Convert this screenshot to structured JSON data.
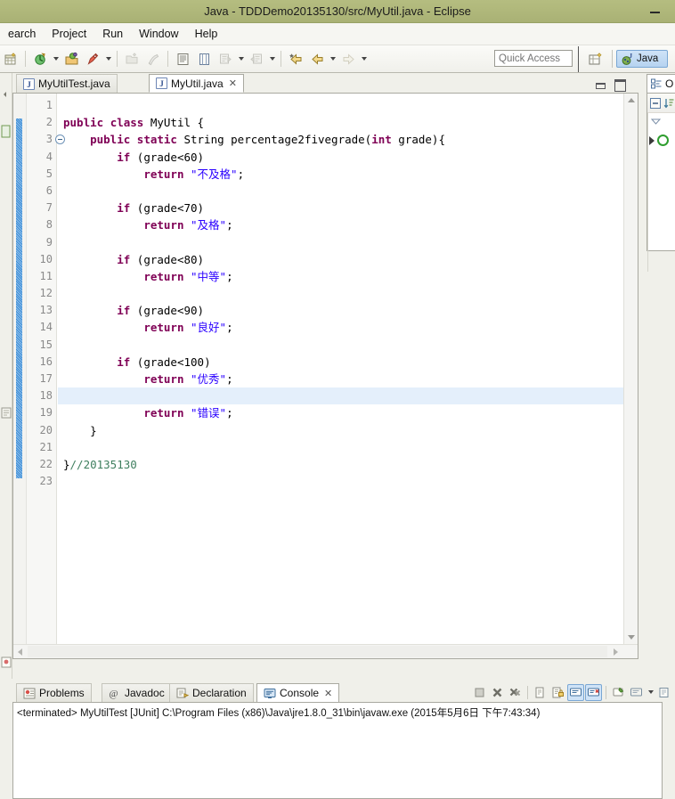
{
  "window": {
    "title": "Java - TDDDemo20135130/src/MyUtil.java - Eclipse",
    "minimize_label": "Minimize",
    "titlebar_color": "#b0b87b"
  },
  "menubar": {
    "items": [
      {
        "label": "earch",
        "name": "menu-search"
      },
      {
        "label": "Project",
        "name": "menu-project"
      },
      {
        "label": "Run",
        "name": "menu-run"
      },
      {
        "label": "Window",
        "name": "menu-window"
      },
      {
        "label": "Help",
        "name": "menu-help"
      }
    ]
  },
  "toolbar": {
    "buttons": [
      {
        "icon": "new-wizard-icon",
        "label": "New"
      },
      {
        "icon": "debug-icon",
        "label": "Debug"
      },
      {
        "icon": "run-icon",
        "label": "Run"
      },
      {
        "icon": "run-external-tools-icon",
        "label": "External Tools"
      },
      {
        "icon": "new-java-package-icon",
        "label": "New Java Package"
      },
      {
        "icon": "skip-breakpoints-icon",
        "label": "Skip All Breakpoints"
      },
      {
        "icon": "open-type-icon",
        "label": "Open Type"
      },
      {
        "icon": "open-task-icon",
        "label": "Open Task"
      },
      {
        "icon": "next-annotation-icon",
        "label": "Next Annotation"
      },
      {
        "icon": "previous-annotation-icon",
        "label": "Previous Annotation"
      },
      {
        "icon": "back-icon",
        "label": "Back"
      },
      {
        "icon": "forward-icon",
        "label": "Forward"
      }
    ],
    "quick_access_placeholder": "Quick Access",
    "open_perspective_label": "Open Perspective",
    "perspective_label": "Java"
  },
  "editor": {
    "tabs": [
      {
        "label": "MyUtilTest.java",
        "active": false,
        "closable": false
      },
      {
        "label": "MyUtil.java",
        "active": true,
        "closable": true,
        "close_glyph": "✕"
      }
    ],
    "minimize_label": "Minimize",
    "maximize_label": "Maximize",
    "current_line": 18,
    "lines": [
      {
        "n": 1,
        "folds": false,
        "tokens": []
      },
      {
        "n": 2,
        "folds": false,
        "tokens": [
          {
            "t": "public",
            "c": "kw"
          },
          {
            "t": " ",
            "c": "id"
          },
          {
            "t": "class",
            "c": "kw"
          },
          {
            "t": " MyUtil {",
            "c": "id"
          }
        ]
      },
      {
        "n": 3,
        "folds": true,
        "tokens": [
          {
            "t": "    ",
            "c": "id"
          },
          {
            "t": "public",
            "c": "kw"
          },
          {
            "t": " ",
            "c": "id"
          },
          {
            "t": "static",
            "c": "kw"
          },
          {
            "t": " String percentage2fivegrade(",
            "c": "id"
          },
          {
            "t": "int",
            "c": "kw"
          },
          {
            "t": " grade){",
            "c": "id"
          }
        ]
      },
      {
        "n": 4,
        "folds": false,
        "tokens": [
          {
            "t": "        ",
            "c": "id"
          },
          {
            "t": "if",
            "c": "kw"
          },
          {
            "t": " (grade<60)",
            "c": "id"
          }
        ]
      },
      {
        "n": 5,
        "folds": false,
        "tokens": [
          {
            "t": "            ",
            "c": "id"
          },
          {
            "t": "return",
            "c": "kw"
          },
          {
            "t": " ",
            "c": "id"
          },
          {
            "t": "\"不及格\"",
            "c": "str"
          },
          {
            "t": ";",
            "c": "id"
          }
        ]
      },
      {
        "n": 6,
        "folds": false,
        "tokens": []
      },
      {
        "n": 7,
        "folds": false,
        "tokens": [
          {
            "t": "        ",
            "c": "id"
          },
          {
            "t": "if",
            "c": "kw"
          },
          {
            "t": " (grade<70)",
            "c": "id"
          }
        ]
      },
      {
        "n": 8,
        "folds": false,
        "tokens": [
          {
            "t": "            ",
            "c": "id"
          },
          {
            "t": "return",
            "c": "kw"
          },
          {
            "t": " ",
            "c": "id"
          },
          {
            "t": "\"及格\"",
            "c": "str"
          },
          {
            "t": ";",
            "c": "id"
          }
        ]
      },
      {
        "n": 9,
        "folds": false,
        "tokens": []
      },
      {
        "n": 10,
        "folds": false,
        "tokens": [
          {
            "t": "        ",
            "c": "id"
          },
          {
            "t": "if",
            "c": "kw"
          },
          {
            "t": " (grade<80)",
            "c": "id"
          }
        ]
      },
      {
        "n": 11,
        "folds": false,
        "tokens": [
          {
            "t": "            ",
            "c": "id"
          },
          {
            "t": "return",
            "c": "kw"
          },
          {
            "t": " ",
            "c": "id"
          },
          {
            "t": "\"中等\"",
            "c": "str"
          },
          {
            "t": ";",
            "c": "id"
          }
        ]
      },
      {
        "n": 12,
        "folds": false,
        "tokens": []
      },
      {
        "n": 13,
        "folds": false,
        "tokens": [
          {
            "t": "        ",
            "c": "id"
          },
          {
            "t": "if",
            "c": "kw"
          },
          {
            "t": " (grade<90)",
            "c": "id"
          }
        ]
      },
      {
        "n": 14,
        "folds": false,
        "tokens": [
          {
            "t": "            ",
            "c": "id"
          },
          {
            "t": "return",
            "c": "kw"
          },
          {
            "t": " ",
            "c": "id"
          },
          {
            "t": "\"良好\"",
            "c": "str"
          },
          {
            "t": ";",
            "c": "id"
          }
        ]
      },
      {
        "n": 15,
        "folds": false,
        "tokens": []
      },
      {
        "n": 16,
        "folds": false,
        "tokens": [
          {
            "t": "        ",
            "c": "id"
          },
          {
            "t": "if",
            "c": "kw"
          },
          {
            "t": " (grade<100)",
            "c": "id"
          }
        ]
      },
      {
        "n": 17,
        "folds": false,
        "tokens": [
          {
            "t": "            ",
            "c": "id"
          },
          {
            "t": "return",
            "c": "kw"
          },
          {
            "t": " ",
            "c": "id"
          },
          {
            "t": "\"优秀\"",
            "c": "str"
          },
          {
            "t": ";",
            "c": "id"
          }
        ]
      },
      {
        "n": 18,
        "folds": false,
        "tokens": []
      },
      {
        "n": 19,
        "folds": false,
        "tokens": [
          {
            "t": "            ",
            "c": "id"
          },
          {
            "t": "return",
            "c": "kw"
          },
          {
            "t": " ",
            "c": "id"
          },
          {
            "t": "\"错误\"",
            "c": "str"
          },
          {
            "t": ";",
            "c": "id"
          }
        ]
      },
      {
        "n": 20,
        "folds": false,
        "tokens": [
          {
            "t": "    }",
            "c": "id"
          }
        ]
      },
      {
        "n": 21,
        "folds": false,
        "tokens": []
      },
      {
        "n": 22,
        "folds": false,
        "tokens": [
          {
            "t": "}",
            "c": "id"
          },
          {
            "t": "//20135130",
            "c": "cmt"
          }
        ]
      },
      {
        "n": 23,
        "folds": false,
        "tokens": []
      }
    ]
  },
  "outline": {
    "tab_label": "O",
    "collapse_all_label": "Collapse All",
    "sort_label": "Sort",
    "menu_label": "View Menu"
  },
  "bottom": {
    "tabs": [
      {
        "label": "Problems",
        "icon": "problems-icon",
        "active": false,
        "closable": false
      },
      {
        "label": "Javadoc",
        "icon": "javadoc-icon",
        "active": false,
        "closable": false
      },
      {
        "label": "Declaration",
        "icon": "declaration-icon",
        "active": false,
        "closable": false
      },
      {
        "label": "Console",
        "icon": "console-icon",
        "active": true,
        "closable": true,
        "close_glyph": "✕"
      }
    ],
    "console_tools": [
      {
        "icon": "terminate-icon",
        "label": "Terminate",
        "selected": false
      },
      {
        "icon": "remove-launch-icon",
        "label": "Remove Launch",
        "selected": false
      },
      {
        "icon": "remove-all-launches-icon",
        "label": "Remove All Terminated Launches",
        "selected": false
      },
      {
        "icon": "clear-console-icon",
        "label": "Clear Console",
        "selected": false
      },
      {
        "icon": "scroll-lock-icon",
        "label": "Scroll Lock",
        "selected": false
      },
      {
        "icon": "show-console-on-output-icon",
        "label": "Show Console When Standard Out Changes",
        "selected": true
      },
      {
        "icon": "show-console-on-error-icon",
        "label": "Show Console When Standard Error Changes",
        "selected": true
      },
      {
        "icon": "pin-console-icon",
        "label": "Pin Console",
        "selected": false
      },
      {
        "icon": "display-selected-console-icon",
        "label": "Display Selected Console",
        "selected": false
      },
      {
        "icon": "open-console-icon",
        "label": "Open Console",
        "selected": false
      }
    ],
    "console_output": "<terminated> MyUtilTest [JUnit] C:\\Program Files (x86)\\Java\\jre1.8.0_31\\bin\\javaw.exe (2015年5月6日 下午7:43:34)"
  },
  "colors": {
    "keyword": "#7f0055",
    "string": "#2a00ff",
    "comment": "#3f7f5f",
    "current_line": "#e4effb",
    "selection_blue": "#cfe3f7"
  }
}
